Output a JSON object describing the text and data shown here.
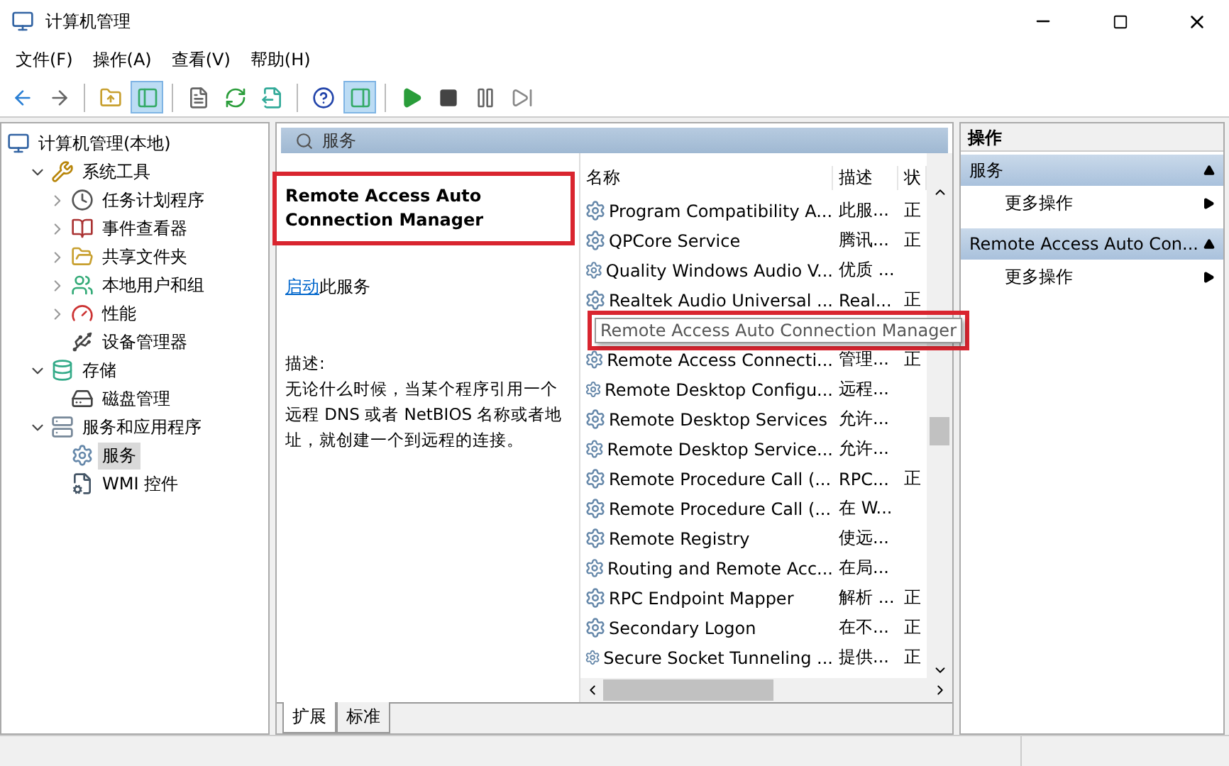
{
  "window": {
    "title": "计算机管理"
  },
  "menu": [
    "文件(F)",
    "操作(A)",
    "查看(V)",
    "帮助(H)"
  ],
  "toolbar": [
    {
      "kind": "up",
      "selected": false
    },
    {
      "kind": "tree",
      "selected": true
    },
    {
      "kind": "props",
      "selected": false
    },
    {
      "kind": "refresh",
      "selected": false
    },
    {
      "kind": "export",
      "selected": false
    },
    {
      "kind": "help",
      "selected": false
    },
    {
      "kind": "pane",
      "selected": true
    }
  ],
  "tree": [
    {
      "label": "计算机管理(本地)",
      "selected": false,
      "children": [
        {
          "label": "系统工具",
          "expanded": true,
          "selected": false,
          "children": [
            {
              "label": "任务计划程序",
              "expanded": false,
              "selected": false
            },
            {
              "label": "事件查看器",
              "expanded": false,
              "selected": false
            },
            {
              "label": "共享文件夹",
              "expanded": false,
              "selected": false
            },
            {
              "label": "本地用户和组",
              "expanded": false,
              "selected": false
            },
            {
              "label": "性能",
              "expanded": false,
              "selected": false
            },
            {
              "label": "设备管理器",
              "selected": false
            }
          ]
        },
        {
          "label": "存储",
          "expanded": true,
          "selected": false,
          "children": [
            {
              "label": "磁盘管理",
              "selected": false
            }
          ]
        },
        {
          "label": "服务和应用程序",
          "expanded": true,
          "selected": false,
          "children": [
            {
              "label": "服务",
              "selected": true
            },
            {
              "label": "WMI 控件",
              "selected": false
            }
          ]
        }
      ]
    }
  ],
  "services_header": "服务",
  "detail": {
    "title": "Remote Access Auto Connection Manager",
    "highlighted": true,
    "link": "启动",
    "link_rest": "此服务",
    "desc_label": "描述:",
    "description": "无论什么时候，当某个程序引用一个远程 DNS 或者 NetBIOS 名称或者地址，就创建一个到远程的连接。"
  },
  "table": {
    "columns": [
      "名称",
      "描述",
      "状"
    ],
    "rows": [
      {
        "kind": "row",
        "name": "Program Compatibility A...",
        "desc": "此服...",
        "status": "正"
      },
      {
        "kind": "row",
        "name": "QPCore Service",
        "desc": "腾讯...",
        "status": "正"
      },
      {
        "kind": "row",
        "name": "Quality Windows Audio V...",
        "desc": "优质 ...",
        "status": ""
      },
      {
        "kind": "row",
        "name": "Realtek Audio Universal ...",
        "desc": "Real...",
        "status": "正"
      },
      {
        "kind": "tooltip",
        "name": "Remote Access Auto Connection Manager",
        "highlighted": true
      },
      {
        "kind": "row",
        "name": "Remote Access Connecti...",
        "desc": "管理...",
        "status": "正"
      },
      {
        "kind": "row",
        "name": "Remote Desktop Configu...",
        "desc": "远程...",
        "status": ""
      },
      {
        "kind": "row",
        "name": "Remote Desktop Services",
        "desc": "允许...",
        "status": ""
      },
      {
        "kind": "row",
        "name": "Remote Desktop Service...",
        "desc": "允许...",
        "status": ""
      },
      {
        "kind": "row",
        "name": "Remote Procedure Call (...",
        "desc": "RPC...",
        "status": "正"
      },
      {
        "kind": "row",
        "name": "Remote Procedure Call (...",
        "desc": "在 W...",
        "status": ""
      },
      {
        "kind": "row",
        "name": "Remote Registry",
        "desc": "使远...",
        "status": ""
      },
      {
        "kind": "row",
        "name": "Routing and Remote Acc...",
        "desc": "在局...",
        "status": ""
      },
      {
        "kind": "row",
        "name": "RPC Endpoint Mapper",
        "desc": "解析 ...",
        "status": "正"
      },
      {
        "kind": "row",
        "name": "Secondary Logon",
        "desc": "在不...",
        "status": "正"
      },
      {
        "kind": "row",
        "name": "Secure Socket Tunneling ...",
        "desc": "提供...",
        "status": "正"
      }
    ]
  },
  "bottom_tabs": [
    {
      "label": "扩展",
      "selected": true
    },
    {
      "label": "标准",
      "selected": false
    }
  ],
  "actions": {
    "title": "操作",
    "sections": [
      {
        "header": "服务",
        "items": [
          "更多操作"
        ]
      },
      {
        "header": "Remote Access Auto Con...",
        "items": [
          "更多操作"
        ]
      }
    ]
  }
}
